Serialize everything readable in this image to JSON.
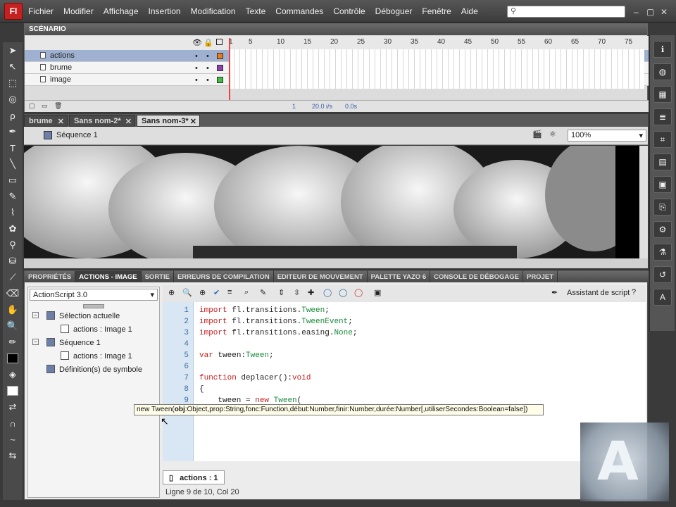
{
  "app": {
    "logo": "Fl"
  },
  "menu": [
    "Fichier",
    "Modifier",
    "Affichage",
    "Insertion",
    "Modification",
    "Texte",
    "Commandes",
    "Contrôle",
    "Déboguer",
    "Fenêtre",
    "Aide"
  ],
  "window_controls": [
    "–",
    "▢",
    "✕"
  ],
  "timeline": {
    "title": "SCÉNARIO",
    "layers": [
      {
        "name": "actions",
        "selected": true
      },
      {
        "name": "brume",
        "selected": false
      },
      {
        "name": "image",
        "selected": false
      }
    ],
    "frame_numbers": [
      "1",
      "5",
      "10",
      "15",
      "20",
      "25",
      "30",
      "35",
      "40",
      "45",
      "50",
      "55",
      "60",
      "65",
      "70",
      "75"
    ],
    "footer": {
      "frame": "1",
      "fps": "20.0 i/s",
      "time": "0.0s"
    }
  },
  "doc_tabs": [
    {
      "label": "brume",
      "active": false
    },
    {
      "label": "Sans nom-2*",
      "active": false
    },
    {
      "label": "Sans nom-3*",
      "active": true
    }
  ],
  "editbar": {
    "scene": "Séquence 1",
    "zoom": "100%"
  },
  "panel": {
    "tabs": [
      {
        "label": "PROPRIÉTÉS",
        "active": false
      },
      {
        "label": "ACTIONS - IMAGE",
        "active": true
      },
      {
        "label": "SORTIE",
        "active": false
      },
      {
        "label": "ERREURS DE COMPILATION",
        "active": false
      },
      {
        "label": "EDITEUR DE MOUVEMENT",
        "active": false
      },
      {
        "label": "PALETTE YAZO 6",
        "active": false
      },
      {
        "label": "CONSOLE DE DÉBOGAGE",
        "active": false
      },
      {
        "label": "PROJET",
        "active": false
      }
    ],
    "script_version": "ActionScript 3.0",
    "tree": [
      {
        "label": "Sélection actuelle",
        "indent": 1
      },
      {
        "label": "actions : Image 1",
        "indent": 2
      },
      {
        "label": "Séquence 1",
        "indent": 1
      },
      {
        "label": "actions : Image 1",
        "indent": 2
      },
      {
        "label": "Définition(s) de symbole",
        "indent": 1
      }
    ],
    "assistant": "Assistant de script",
    "code_lines": [
      {
        "n": "1",
        "t": "import fl.transitions.Tween;"
      },
      {
        "n": "2",
        "t": "import fl.transitions.TweenEvent;"
      },
      {
        "n": "3",
        "t": "import fl.transitions.easing.None;"
      },
      {
        "n": "4",
        "t": ""
      },
      {
        "n": "5",
        "t": "var tween:Tween;"
      },
      {
        "n": "6",
        "t": ""
      },
      {
        "n": "7",
        "t": "function deplacer():void"
      },
      {
        "n": "8",
        "t": "{"
      },
      {
        "n": "9",
        "t": "    tween = new Tween("
      },
      {
        "n": "10",
        "t": ""
      }
    ],
    "tooltip": "new Tween(obj:Object,prop:String,fonc:Function,début:Number,finir:Number,durée:Number[,utiliserSecondes:Boolean=false])",
    "code_tab": "actions : 1",
    "status": "Ligne 9 de 10, Col 20"
  },
  "colors": {
    "layer_actions": "#e87b1e",
    "layer_brume": "#8e3fb0",
    "layer_image": "#3fbf3f",
    "keyword": "#c81e1e",
    "type": "#1a8a3a"
  }
}
